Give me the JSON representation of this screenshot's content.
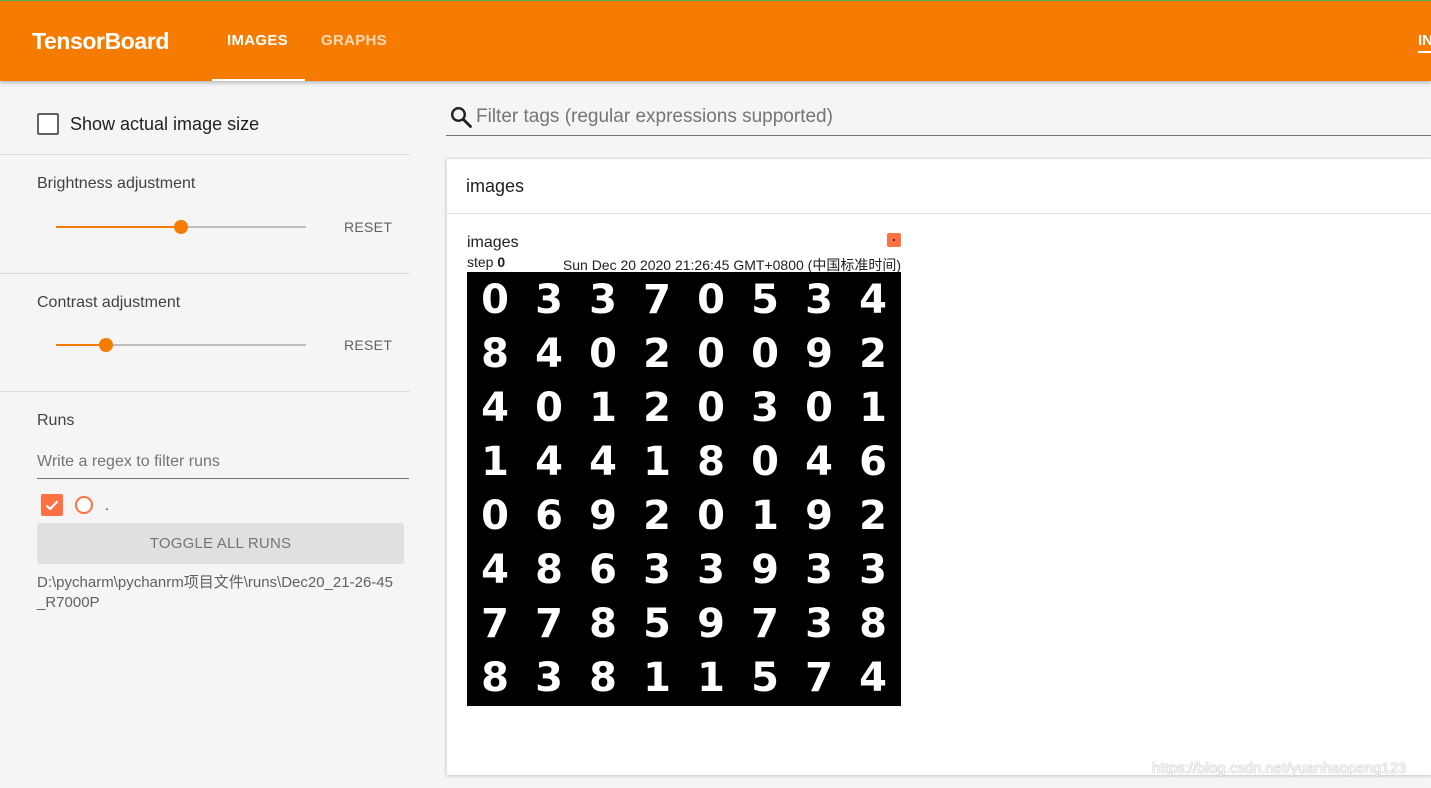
{
  "header": {
    "brand": "TensorBoard",
    "tabs": [
      {
        "label": "IMAGES",
        "active": true
      },
      {
        "label": "GRAPHS",
        "active": false
      }
    ],
    "overflow_tab": "IN",
    "accent_color": "#f57c00"
  },
  "sidebar": {
    "show_actual_size_label": "Show actual image size",
    "show_actual_size_checked": false,
    "brightness": {
      "label": "Brightness adjustment",
      "level": 0.5,
      "reset_label": "RESET"
    },
    "contrast": {
      "label": "Contrast adjustment",
      "level": 0.2,
      "reset_label": "RESET"
    },
    "runs": {
      "title": "Runs",
      "filter_placeholder": "Write a regex to filter runs",
      "items": [
        {
          "name": ".",
          "checked": true,
          "color": "#ff7043"
        }
      ],
      "toggle_all_label": "TOGGLE ALL RUNS",
      "path": "D:\\pycharm\\pychanrm项目文件\\runs\\Dec20_21-26-45_R7000P"
    }
  },
  "main": {
    "filter_placeholder": "Filter tags (regular expressions supported)",
    "card": {
      "title": "images",
      "image_name": "images",
      "step_label": "step",
      "step_value": "0",
      "wall_time": "Sun Dec 20 2020 21:26:45 GMT+0800 (中国标准时间)",
      "digits": [
        [
          "0",
          "3",
          "3",
          "7",
          "0",
          "5",
          "3",
          "4"
        ],
        [
          "8",
          "4",
          "0",
          "2",
          "0",
          "0",
          "9",
          "2"
        ],
        [
          "4",
          "0",
          "1",
          "2",
          "0",
          "3",
          "0",
          "1"
        ],
        [
          "1",
          "4",
          "4",
          "1",
          "8",
          "0",
          "4",
          "6"
        ],
        [
          "0",
          "6",
          "9",
          "2",
          "0",
          "1",
          "9",
          "2"
        ],
        [
          "4",
          "8",
          "6",
          "3",
          "3",
          "9",
          "3",
          "3"
        ],
        [
          "7",
          "7",
          "8",
          "5",
          "9",
          "7",
          "3",
          "8"
        ],
        [
          "8",
          "3",
          "8",
          "1",
          "1",
          "5",
          "7",
          "4"
        ]
      ]
    }
  },
  "watermark": "https://blog.csdn.net/yuanhaopeng123"
}
